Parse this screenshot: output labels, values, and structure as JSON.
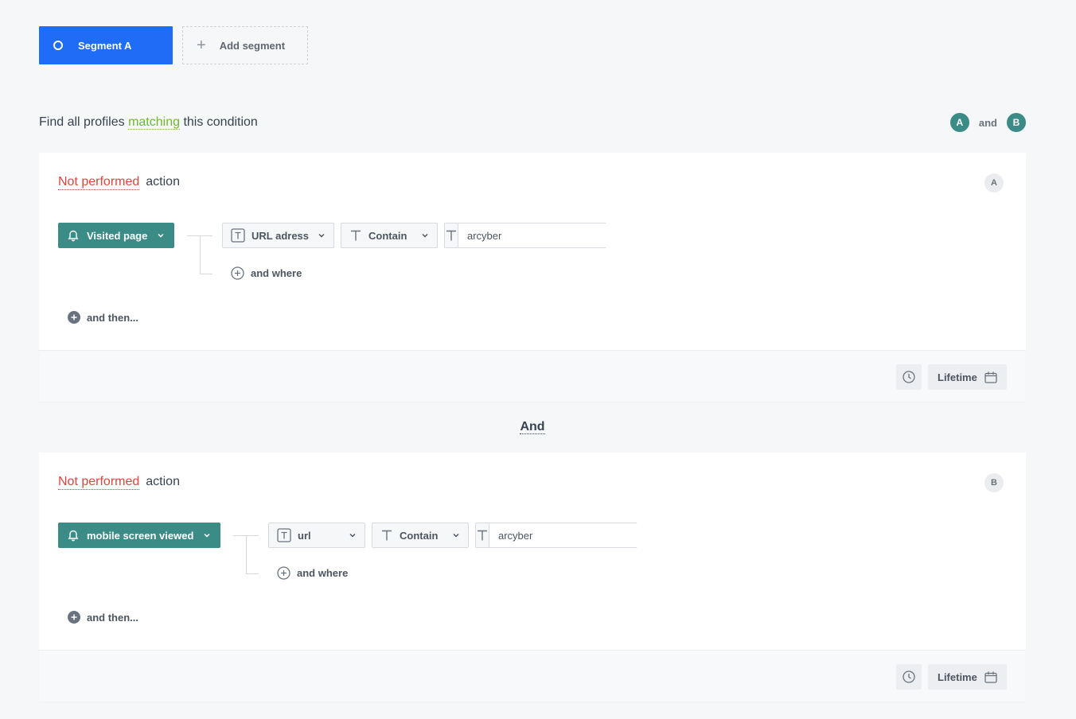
{
  "segments": {
    "active_label": "Segment A",
    "add_label": "Add segment"
  },
  "find": {
    "prefix": "Find all profiles",
    "mode": "matching",
    "suffix": "this condition",
    "legend_a": "A",
    "legend_and": "and",
    "legend_b": "B"
  },
  "conditions": [
    {
      "letter": "A",
      "negation": "Not performed",
      "action_word": "action",
      "event": "Visited page",
      "param": "URL adress",
      "operator": "Contain",
      "value": "arcyber",
      "and_where": "and where",
      "and_then": "and then...",
      "time_range": "Lifetime"
    },
    {
      "letter": "B",
      "negation": "Not performed",
      "action_word": "action",
      "event": "mobile screen viewed",
      "param": "url",
      "operator": "Contain",
      "value": "arcyber",
      "and_where": "and where",
      "and_then": "and then...",
      "time_range": "Lifetime"
    }
  ],
  "separator": "And",
  "colors": {
    "primary_blue": "#1f6cf7",
    "teal": "#3b8b87",
    "negation_red": "#e0443a",
    "match_green": "#6dbb2c"
  },
  "icons": {
    "segment": "ring-icon",
    "add": "plus-icon",
    "event": "bell-icon",
    "chevron": "chevron-down-icon",
    "type": "text-type-icon",
    "add_where": "plus-circle-icon",
    "add_then": "plus-circle-filled-icon",
    "clock": "clock-icon",
    "calendar": "calendar-icon"
  }
}
